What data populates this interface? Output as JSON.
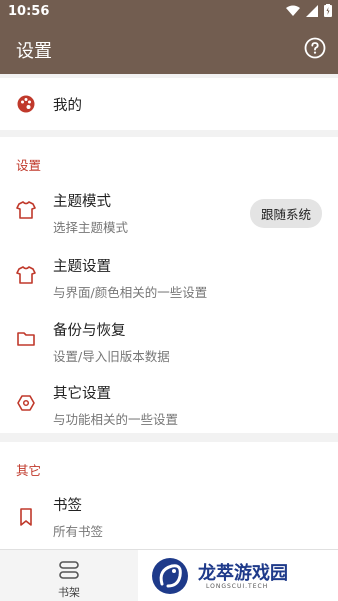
{
  "status": {
    "time": "10:56"
  },
  "appbar": {
    "title": "设置",
    "help_icon": "help-circle-icon"
  },
  "profile": {
    "label": "我的",
    "icon": "palette-icon"
  },
  "sections": {
    "settings": {
      "label": "设置"
    },
    "other": {
      "label": "其它"
    }
  },
  "settings_items": [
    {
      "title": "主题模式",
      "subtitle": "选择主题模式",
      "icon": "shirt-icon",
      "chip": "跟随系统"
    },
    {
      "title": "主题设置",
      "subtitle": "与界面/颜色相关的一些设置",
      "icon": "shirt-icon"
    },
    {
      "title": "备份与恢复",
      "subtitle": "设置/导入旧版本数据",
      "icon": "folder-icon"
    },
    {
      "title": "其它设置",
      "subtitle": "与功能相关的一些设置",
      "icon": "hexagon-icon"
    }
  ],
  "other_items": [
    {
      "title": "书签",
      "subtitle": "所有书签",
      "icon": "bookmark-icon"
    }
  ],
  "bottom_nav": {
    "bookshelf_label": "书架"
  },
  "watermark": {
    "name": "龙萃游戏园",
    "sub": "LONGSCUI.TECH"
  },
  "colors": {
    "appbar": "#725d50",
    "accent": "#c0392b",
    "background": "#f2f2f2"
  }
}
